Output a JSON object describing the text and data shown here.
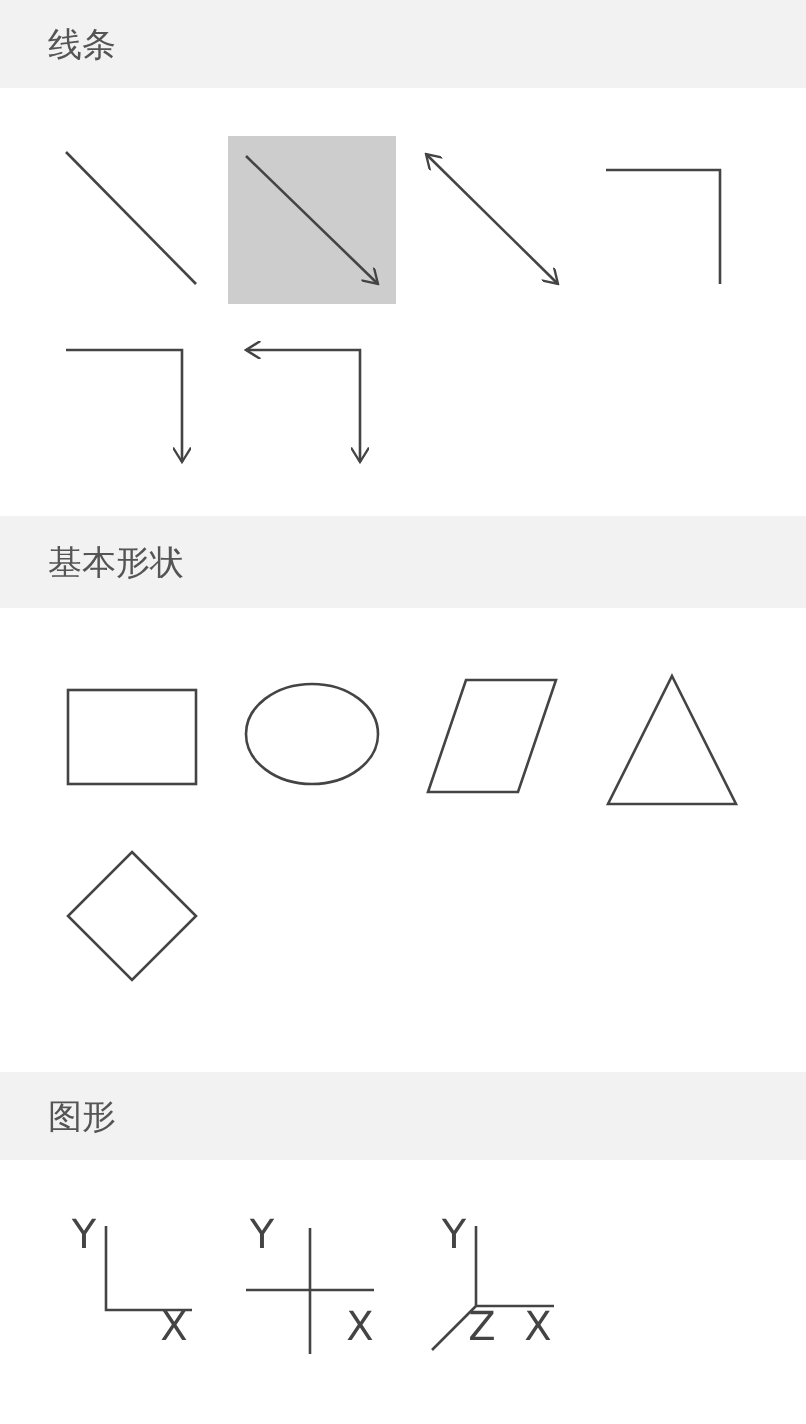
{
  "sections": [
    {
      "title": "线条",
      "items": [
        {
          "kind": "line",
          "selected": false
        },
        {
          "kind": "arrow",
          "selected": true
        },
        {
          "kind": "double-arrow",
          "selected": false
        },
        {
          "kind": "elbow",
          "selected": false
        },
        {
          "kind": "elbow-arrow",
          "selected": false
        },
        {
          "kind": "elbow-double-arrow",
          "selected": false
        }
      ]
    },
    {
      "title": "基本形状",
      "items": [
        {
          "kind": "rectangle",
          "selected": false
        },
        {
          "kind": "ellipse",
          "selected": false
        },
        {
          "kind": "parallelogram",
          "selected": false
        },
        {
          "kind": "triangle",
          "selected": false
        },
        {
          "kind": "diamond",
          "selected": false
        }
      ]
    },
    {
      "title": "图形",
      "items": [
        {
          "kind": "axes-corner",
          "selected": false,
          "y_label": "Y",
          "x_label": "X"
        },
        {
          "kind": "axes-cross",
          "selected": false,
          "y_label": "Y",
          "x_label": "X"
        },
        {
          "kind": "axes-3d",
          "selected": false,
          "y_label": "Y",
          "z_label": "Z",
          "x_label": "X"
        }
      ]
    }
  ]
}
